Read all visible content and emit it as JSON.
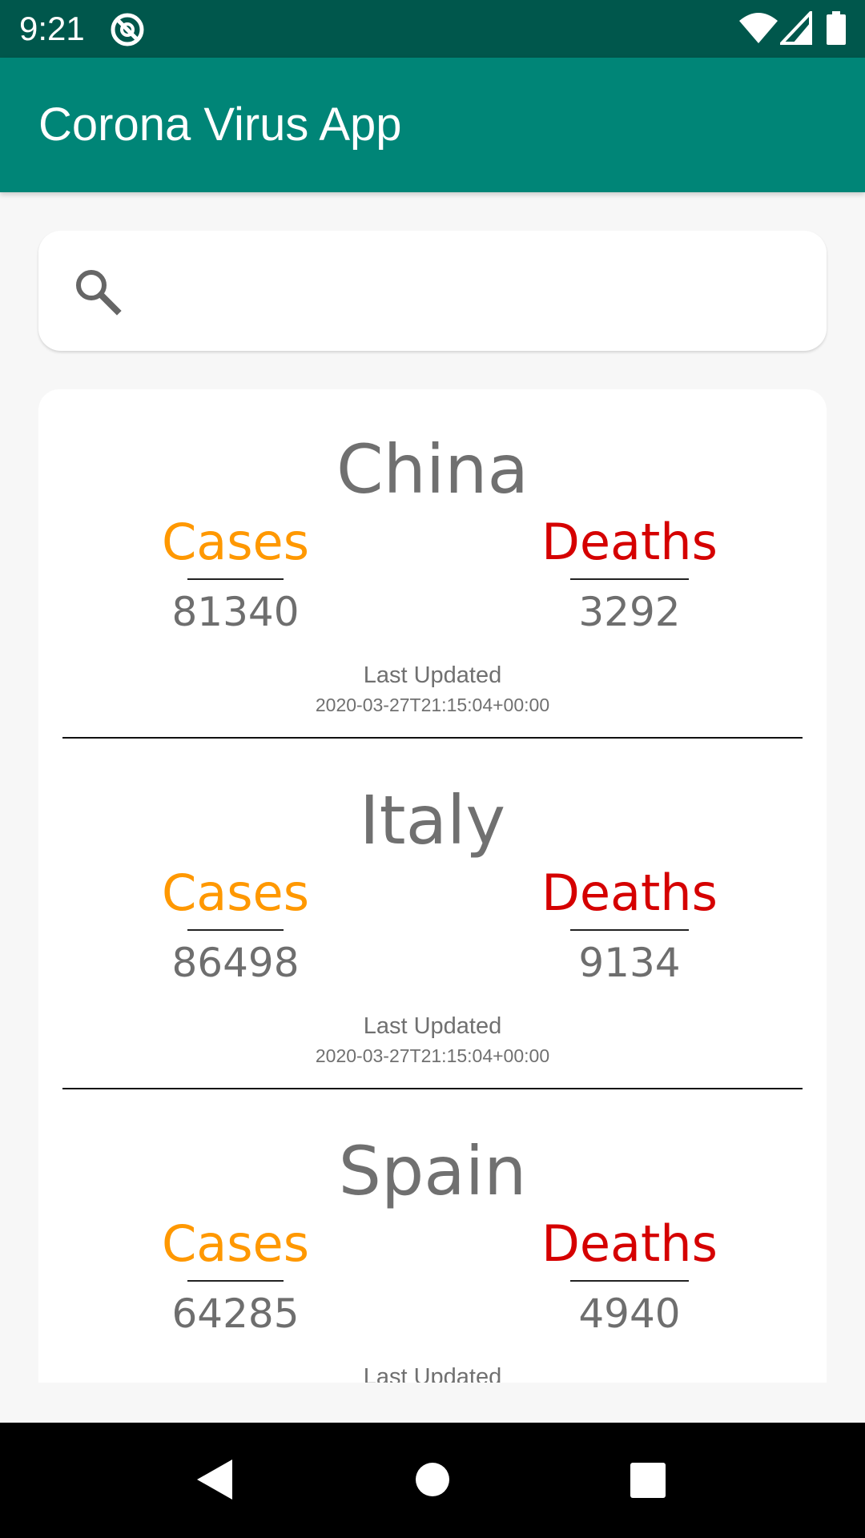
{
  "status_bar": {
    "time": "9:21",
    "icons": [
      "app-notification-icon",
      "wifi-icon",
      "cell-signal-icon",
      "battery-icon"
    ]
  },
  "app_bar": {
    "title": "Corona Virus App",
    "color": "#008577"
  },
  "search": {
    "value": "",
    "placeholder": "",
    "icon": "search-icon"
  },
  "countries": [
    {
      "name": "China",
      "cases_label": "Cases",
      "cases": "81340",
      "deaths_label": "Deaths",
      "deaths": "3292",
      "updated_label": "Last Updated",
      "updated": "2020-03-27T21:15:04+00:00"
    },
    {
      "name": "Italy",
      "cases_label": "Cases",
      "cases": "86498",
      "deaths_label": "Deaths",
      "deaths": "9134",
      "updated_label": "Last Updated",
      "updated": "2020-03-27T21:15:04+00:00"
    },
    {
      "name": "Spain",
      "cases_label": "Cases",
      "cases": "64285",
      "deaths_label": "Deaths",
      "deaths": "4940",
      "updated_label": "Last Updated",
      "updated": ""
    }
  ],
  "colors": {
    "cases": "#ff9800",
    "deaths": "#d50000",
    "status_bar": "#00574c"
  },
  "nav_bar": {
    "icons": [
      "back-icon",
      "home-icon",
      "recents-icon"
    ]
  }
}
